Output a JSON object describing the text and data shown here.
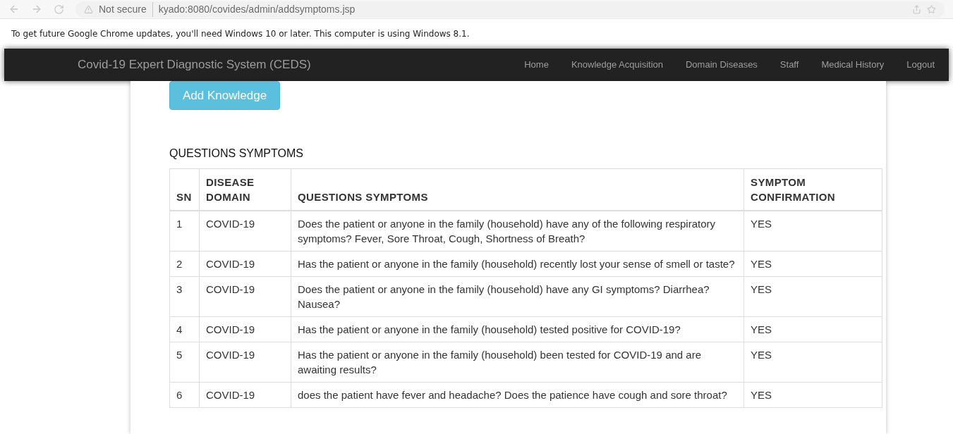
{
  "browser": {
    "security": "Not secure",
    "url": "kyado:8080/covides/admin/addsymptoms.jsp"
  },
  "infobar": {
    "message": "To get future Google Chrome updates, you'll need Windows 10 or later. This computer is using Windows 8.1."
  },
  "navbar": {
    "brand": "Covid-19 Expert Diagnostic System (CEDS)",
    "items": [
      "Home",
      "Knowledge Acquisition",
      "Domain Diseases",
      "Staff",
      "Medical History",
      "Logout"
    ]
  },
  "add_button": "Add Knowledge",
  "section_title": "QUESTIONS SYMPTOMS",
  "table": {
    "columns": [
      "SN",
      "DISEASE DOMAIN",
      "QUESTIONS SYMPTOMS",
      "SYMPTOM CONFIRMATION"
    ],
    "rows": [
      [
        "1",
        "COVID-19",
        "Does the patient or anyone in the family (household) have any of the following respiratory symptoms? Fever, Sore Throat, Cough, Shortness of Breath?",
        "YES"
      ],
      [
        "2",
        "COVID-19",
        "Has the patient or anyone in the family (household) recently lost your sense of smell or taste?",
        "YES"
      ],
      [
        "3",
        "COVID-19",
        "Does the patient or anyone in the family (household) have any GI symptoms? Diarrhea? Nausea?",
        "YES"
      ],
      [
        "4",
        "COVID-19",
        "Has the patient or anyone in the family (household) tested positive for COVID-19?",
        "YES"
      ],
      [
        "5",
        "COVID-19",
        "Has the patient or anyone in the family (household) been tested for COVID-19 and are awaiting results?",
        "YES"
      ],
      [
        "6",
        "COVID-19",
        "does the patient have fever and headache? Does the patience have cough and sore throat?",
        "YES"
      ]
    ]
  }
}
